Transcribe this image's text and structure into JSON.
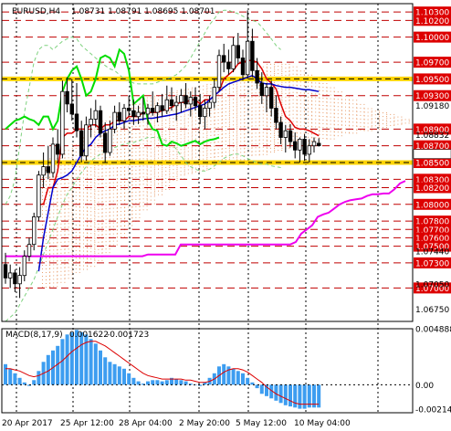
{
  "chart_data": {
    "type": "candlestick",
    "symbol_title": "EURUSD,H4",
    "ohlc_header": "1.08731 1.08791 1.08695 1.08701",
    "price_axis": {
      "range": [
        1.066,
        1.104
      ],
      "tick_labels": [
        "1.10300",
        "1.10200",
        "1.10000",
        "1.09700",
        "1.09500",
        "1.09300",
        "1.09180",
        "1.08900",
        "1.08832",
        "1.08700",
        "1.08500",
        "1.08300",
        "1.08200",
        "1.08000",
        "1.07800",
        "1.07700",
        "1.07600",
        "1.07500",
        "1.07440",
        "1.07300",
        "1.07050",
        "1.07000",
        "1.06750"
      ],
      "highlighted_levels": [
        {
          "label": "1.10300",
          "value": 1.103
        },
        {
          "label": "1.10200",
          "value": 1.102
        },
        {
          "label": "1.10000",
          "value": 1.1
        },
        {
          "label": "1.09700",
          "value": 1.097
        },
        {
          "label": "1.09500",
          "value": 1.095
        },
        {
          "label": "1.09300",
          "value": 1.093
        },
        {
          "label": "1.08900",
          "value": 1.089
        },
        {
          "label": "1.08700",
          "value": 1.087
        },
        {
          "label": "1.08500",
          "value": 1.085
        },
        {
          "label": "1.08300",
          "value": 1.083
        },
        {
          "label": "1.08200",
          "value": 1.082
        },
        {
          "label": "1.08000",
          "value": 1.08
        },
        {
          "label": "1.07800",
          "value": 1.078
        },
        {
          "label": "1.07700",
          "value": 1.077
        },
        {
          "label": "1.07600",
          "value": 1.076
        },
        {
          "label": "1.07500",
          "value": 1.075
        },
        {
          "label": "1.07300",
          "value": 1.073
        },
        {
          "label": "1.07000",
          "value": 1.07
        }
      ],
      "plain_labels": [
        {
          "label": "1.09180",
          "value": 1.0918
        },
        {
          "label": "1.08832",
          "value": 1.08832
        },
        {
          "label": "1.07440",
          "value": 1.0744
        },
        {
          "label": "1.07050",
          "value": 1.0705
        },
        {
          "label": "1.06750",
          "value": 1.0675
        }
      ],
      "current_price_marker": "1.08701"
    },
    "time_axis": {
      "labels": [
        "20 Apr 2017",
        "25 Apr 12:00",
        "28 Apr 04:00",
        "2 May 20:00",
        "5 May 12:00",
        "10 May 04:00"
      ]
    },
    "yellow_levels": [
      1.095,
      1.085
    ],
    "candles": [
      [
        1.0728,
        1.0742,
        1.0705,
        1.0712
      ],
      [
        1.0712,
        1.0728,
        1.07,
        1.0718
      ],
      [
        1.0718,
        1.0722,
        1.0695,
        1.0705
      ],
      [
        1.0705,
        1.0725,
        1.0688,
        1.0715
      ],
      [
        1.0715,
        1.0745,
        1.0708,
        1.0738
      ],
      [
        1.0738,
        1.076,
        1.0732,
        1.0752
      ],
      [
        1.0752,
        1.079,
        1.0745,
        1.0785
      ],
      [
        1.0785,
        1.084,
        1.078,
        1.0835
      ],
      [
        1.0835,
        1.0862,
        1.082,
        1.0845
      ],
      [
        1.0845,
        1.087,
        1.083,
        1.0838
      ],
      [
        1.0838,
        1.088,
        1.0832,
        1.0872
      ],
      [
        1.0872,
        1.089,
        1.085,
        1.086
      ],
      [
        1.086,
        1.0948,
        1.0855,
        1.0935
      ],
      [
        1.0935,
        1.0952,
        1.091,
        1.092
      ],
      [
        1.092,
        1.095,
        1.09,
        1.0908
      ],
      [
        1.0908,
        1.0945,
        1.088,
        1.0888
      ],
      [
        1.0888,
        1.09,
        1.085,
        1.0858
      ],
      [
        1.0858,
        1.0905,
        1.0852,
        1.0895
      ],
      [
        1.0895,
        1.0915,
        1.088,
        1.0902
      ],
      [
        1.0902,
        1.0925,
        1.0892,
        1.0912
      ],
      [
        1.0912,
        1.0918,
        1.088,
        1.0885
      ],
      [
        1.0885,
        1.0898,
        1.085,
        1.0862
      ],
      [
        1.0862,
        1.09,
        1.0858,
        1.089
      ],
      [
        1.089,
        1.0918,
        1.0885,
        1.091
      ],
      [
        1.091,
        1.0922,
        1.0895,
        1.09
      ],
      [
        1.09,
        1.092,
        1.089,
        1.0915
      ],
      [
        1.0915,
        1.093,
        1.0905,
        1.0912
      ],
      [
        1.0912,
        1.0925,
        1.0895,
        1.0905
      ],
      [
        1.0905,
        1.0918,
        1.0896,
        1.091
      ],
      [
        1.091,
        1.0928,
        1.09,
        1.0908
      ],
      [
        1.0908,
        1.092,
        1.0895,
        1.0915
      ],
      [
        1.0915,
        1.0935,
        1.0906,
        1.091
      ],
      [
        1.091,
        1.0922,
        1.0898,
        1.0918
      ],
      [
        1.0918,
        1.0932,
        1.0905,
        1.0912
      ],
      [
        1.0912,
        1.0942,
        1.0908,
        1.0925
      ],
      [
        1.0925,
        1.094,
        1.0912,
        1.0918
      ],
      [
        1.0918,
        1.093,
        1.09,
        1.0922
      ],
      [
        1.0922,
        1.0938,
        1.091,
        1.093
      ],
      [
        1.093,
        1.0945,
        1.0915,
        1.092
      ],
      [
        1.092,
        1.0935,
        1.0905,
        1.0928
      ],
      [
        1.0928,
        1.094,
        1.0912,
        1.0918
      ],
      [
        1.0918,
        1.0932,
        1.0896,
        1.0905
      ],
      [
        1.0905,
        1.0925,
        1.089,
        1.0915
      ],
      [
        1.0915,
        1.093,
        1.0905,
        1.0922
      ],
      [
        1.0922,
        1.095,
        1.0915,
        1.094
      ],
      [
        1.094,
        1.0985,
        1.0935,
        1.0978
      ],
      [
        1.0978,
        1.0992,
        1.0958,
        1.097
      ],
      [
        1.097,
        1.0985,
        1.0955,
        1.0962
      ],
      [
        1.0962,
        1.1,
        1.0958,
        1.099
      ],
      [
        1.099,
        1.1005,
        1.0968,
        1.0975
      ],
      [
        1.0975,
        1.0985,
        1.0948,
        1.0955
      ],
      [
        1.0955,
        1.1032,
        1.095,
        1.0995
      ],
      [
        1.0995,
        1.101,
        1.0952,
        1.096
      ],
      [
        1.096,
        1.0975,
        1.0938,
        1.0945
      ],
      [
        1.0945,
        1.0958,
        1.092,
        1.093
      ],
      [
        1.093,
        1.0945,
        1.091,
        1.094
      ],
      [
        1.094,
        1.0948,
        1.0905,
        1.0915
      ],
      [
        1.0915,
        1.093,
        1.089,
        1.0898
      ],
      [
        1.0898,
        1.0905,
        1.0872,
        1.088
      ],
      [
        1.088,
        1.0895,
        1.0862,
        1.0888
      ],
      [
        1.0888,
        1.0896,
        1.0868,
        1.0875
      ],
      [
        1.0875,
        1.0886,
        1.0855,
        1.0865
      ],
      [
        1.0865,
        1.088,
        1.085,
        1.0878
      ],
      [
        1.0878,
        1.0884,
        1.0852,
        1.086
      ],
      [
        1.086,
        1.0878,
        1.085,
        1.087
      ],
      [
        1.087,
        1.088,
        1.0862,
        1.0875
      ],
      [
        1.0873,
        1.0879,
        1.0869,
        1.087
      ]
    ],
    "macd": {
      "label": "MACD(8,17,9)",
      "main_value": "0.001622",
      "signal_value": "-0.001723",
      "range": [
        -0.00245,
        0.0049
      ],
      "tick_labels": [
        "0.004888",
        "0.00",
        "-0.002146"
      ],
      "histogram": [
        0.0018,
        0.0014,
        0.001,
        0.0006,
        0.0002,
        -0.0001,
        0.0004,
        0.0012,
        0.002,
        0.0026,
        0.003,
        0.0034,
        0.004,
        0.0044,
        0.0046,
        0.0048,
        0.0046,
        0.0044,
        0.004,
        0.0036,
        0.003,
        0.0024,
        0.002,
        0.0018,
        0.0016,
        0.0014,
        0.001,
        0.0006,
        0.0003,
        0.0001,
        0.0003,
        0.0004,
        0.0004,
        0.0003,
        0.0004,
        0.0006,
        0.0005,
        0.0004,
        0.0003,
        0.0001,
        0.0,
        -0.0001,
        0.0002,
        0.0006,
        0.001,
        0.0016,
        0.0018,
        0.0016,
        0.0014,
        0.0012,
        0.001,
        0.0006,
        0.0002,
        -0.0003,
        -0.0008,
        -0.001,
        -0.0012,
        -0.0014,
        -0.0016,
        -0.0018,
        -0.0019,
        -0.002,
        -0.0021,
        -0.0021,
        -0.002,
        -0.002,
        -0.002
      ],
      "signal": [
        0.0014,
        0.0014,
        0.0013,
        0.0012,
        0.001,
        0.0008,
        0.0007,
        0.0008,
        0.001,
        0.0012,
        0.0015,
        0.0018,
        0.0021,
        0.0025,
        0.0029,
        0.0032,
        0.0035,
        0.0037,
        0.0038,
        0.0038,
        0.0036,
        0.0034,
        0.0031,
        0.0028,
        0.0025,
        0.0022,
        0.0019,
        0.0016,
        0.0013,
        0.001,
        0.0008,
        0.0007,
        0.0006,
        0.0005,
        0.0005,
        0.0005,
        0.0005,
        0.0005,
        0.0004,
        0.0004,
        0.0003,
        0.0002,
        0.0002,
        0.0003,
        0.0005,
        0.0008,
        0.0011,
        0.0013,
        0.0014,
        0.0014,
        0.0013,
        0.0011,
        0.0008,
        0.0005,
        0.0002,
        -0.0002,
        -0.0005,
        -0.0008,
        -0.001,
        -0.0012,
        -0.0014,
        -0.0016,
        -0.0017,
        -0.0017,
        -0.0017,
        -0.0017,
        -0.0017
      ]
    },
    "ichimoku_lines": {
      "red": [
        null,
        null,
        null,
        null,
        null,
        null,
        null,
        1.08,
        1.08,
        1.082,
        1.082,
        1.084,
        1.088,
        1.0885,
        1.0885,
        1.089,
        1.089,
        1.089,
        1.0895,
        1.0895,
        1.089,
        1.0895,
        1.0895,
        1.09,
        1.09,
        1.09,
        1.0905,
        1.0905,
        1.0905,
        1.091,
        1.091,
        1.091,
        1.091,
        1.0912,
        1.0914,
        1.0916,
        1.092,
        1.0922,
        1.0922,
        1.0925,
        1.0925,
        1.092,
        1.0925,
        1.0925,
        1.093,
        1.0935,
        1.095,
        1.0955,
        1.096,
        1.0968,
        1.097,
        1.0972,
        1.0972,
        1.097,
        1.0962,
        1.095,
        1.0945,
        1.0938,
        1.092,
        1.0905,
        1.09,
        1.0892,
        1.089,
        1.089,
        1.0888,
        1.0885,
        1.0882
      ],
      "blue": [
        null,
        null,
        null,
        null,
        null,
        null,
        null,
        1.072,
        1.076,
        1.079,
        1.082,
        1.083,
        1.0832,
        1.0835,
        1.084,
        1.085,
        1.086,
        1.0868,
        1.0872,
        1.088,
        1.0885,
        1.0888,
        1.089,
        1.0895,
        1.0896,
        1.0898,
        1.09,
        1.09,
        1.0901,
        1.0902,
        1.0903,
        1.0903,
        1.0904,
        1.0905,
        1.0906,
        1.0907,
        1.0908,
        1.091,
        1.0912,
        1.0914,
        1.0916,
        1.0918,
        1.092,
        1.0925,
        1.093,
        1.0935,
        1.094,
        1.0944,
        1.0946,
        1.0948,
        1.095,
        1.0952,
        1.0954,
        1.095,
        1.0945,
        1.0944,
        1.0944,
        1.0942,
        1.0941,
        1.094,
        1.094,
        1.0939,
        1.0938,
        1.0937,
        1.0937,
        1.0936,
        1.0935
      ],
      "green": [
        1.089,
        1.0895,
        1.09,
        1.0902,
        1.0905,
        1.0902,
        1.09,
        1.0895,
        1.0905,
        1.0905,
        1.089,
        1.09,
        1.0935,
        1.095,
        1.096,
        1.0965,
        1.095,
        1.093,
        1.0935,
        1.095,
        1.0975,
        1.0978,
        1.0975,
        1.0965,
        1.0985,
        1.098,
        1.096,
        1.092,
        1.0925,
        1.093,
        1.09,
        1.089,
        1.0888,
        1.0872,
        1.087,
        1.0875,
        1.0873,
        1.087,
        1.0872,
        1.0874,
        1.0876,
        1.0872,
        1.0875,
        1.0877,
        1.0878,
        1.088,
        null,
        null,
        null,
        null,
        null,
        null,
        null,
        null,
        null,
        null,
        null,
        null,
        null,
        null,
        null,
        null,
        null,
        null,
        null,
        null,
        null
      ],
      "magenta": [
        1.0738,
        1.0738,
        1.0738,
        1.0738,
        1.0738,
        1.0738,
        1.0738,
        1.0738,
        1.0738,
        1.0738,
        1.0738,
        1.0738,
        1.0738,
        1.0738,
        1.0738,
        1.0738,
        1.0738,
        1.0738,
        1.0738,
        1.0738,
        1.0738,
        1.0738,
        1.0738,
        1.0738,
        1.0738,
        1.0738,
        1.074,
        1.074,
        1.074,
        1.074,
        1.074,
        1.074,
        1.0752,
        1.0752,
        1.0752,
        1.0752,
        1.0752,
        1.0752,
        1.0752,
        1.0752,
        1.0752,
        1.0752,
        1.0752,
        1.0752,
        1.0752,
        1.0752,
        1.0752,
        1.0752,
        1.0752,
        1.0752,
        1.0752,
        1.0752,
        1.0752,
        1.0755,
        1.0765,
        1.077,
        1.0775,
        1.0785,
        1.0788,
        1.079,
        1.0795,
        1.08,
        1.0803,
        1.0805,
        1.0806,
        1.0807,
        1.081,
        1.0812,
        1.0812,
        1.0813,
        1.0813,
        1.0818,
        1.0825,
        1.0828
      ]
    },
    "bollinger": {
      "upper": [
        1.08,
        1.081,
        1.083,
        1.087,
        1.091,
        1.094,
        1.097,
        1.0985,
        1.099,
        1.099,
        1.0985,
        1.099,
        1.0995,
        1.0998,
        1.1,
        1.0998,
        1.099,
        1.0985,
        1.098,
        1.0975,
        1.097,
        1.0966,
        1.0962,
        1.096,
        1.0955,
        1.095,
        1.0948,
        1.0945,
        1.0944,
        1.0944,
        1.0944,
        1.0944,
        1.0946,
        1.0948,
        1.095,
        1.0952,
        1.0955,
        1.096,
        1.0966,
        1.0975,
        1.0985,
        1.0995,
        1.1005,
        1.1015,
        1.1022,
        1.103,
        1.1032,
        1.1032,
        1.103,
        1.1028,
        1.1025,
        1.1022,
        1.102,
        1.1018,
        1.1012,
        1.1005,
        1.0998,
        1.099,
        1.0985
      ],
      "lower": [
        1.066,
        1.0665,
        1.067,
        1.068,
        1.069,
        1.07,
        1.071,
        1.0725,
        1.074,
        1.0755,
        1.077,
        1.0785,
        1.08,
        1.0812,
        1.082,
        1.083,
        1.0838,
        1.0845,
        1.0852,
        1.0856,
        1.086,
        1.0864,
        1.0866,
        1.0868,
        1.087,
        1.0872,
        1.0873,
        1.0874,
        1.0876,
        1.0878,
        1.088,
        1.088,
        1.088,
        1.0878,
        1.0876,
        1.0872,
        1.0866,
        1.0858,
        1.085,
        1.0845,
        1.0842,
        1.084,
        1.084,
        1.0842,
        1.0846,
        1.085,
        1.0855,
        1.0858,
        1.086,
        1.086,
        1.0858,
        1.0855,
        1.0852,
        1.085,
        1.0848,
        1.0848,
        1.0846,
        1.0845,
        1.0844
      ]
    }
  }
}
